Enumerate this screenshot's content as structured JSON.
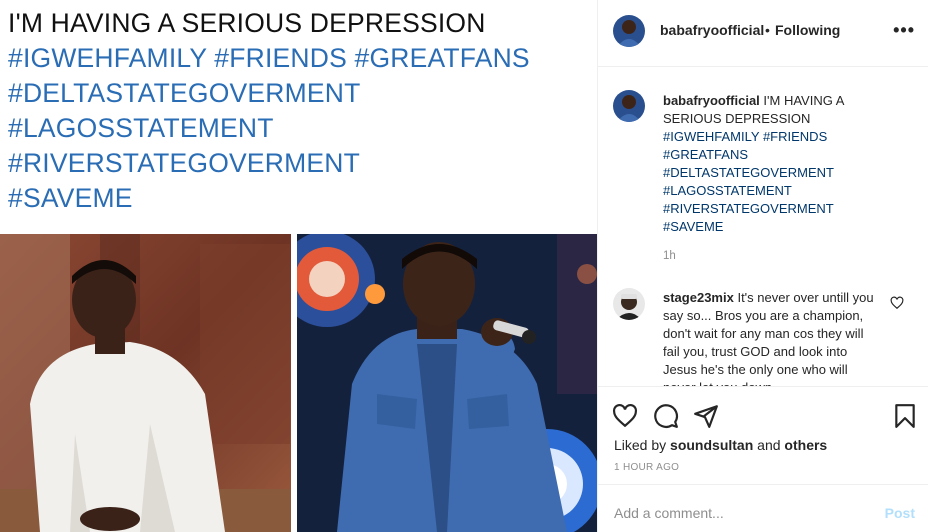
{
  "media": {
    "caption_lines": [
      {
        "text": "I'M HAVING A SERIOUS DEPRESSION",
        "style": "black"
      },
      {
        "text": "#IGWEHFAMILY #FRIENDS #GREATFANS",
        "style": "blue"
      },
      {
        "text": "#DELTASTATEGOVERMENT",
        "style": "blue"
      },
      {
        "text": "#LAGOSSTATEMENT",
        "style": "blue"
      },
      {
        "text": "#RIVERSTATEGOVERMENT",
        "style": "blue"
      },
      {
        "text": "#SAVEME",
        "style": "blue"
      }
    ]
  },
  "header": {
    "username": "babafryoofficial",
    "dot": "•",
    "follow_status": "Following",
    "more": "•••"
  },
  "caption": {
    "username": "babafryoofficial",
    "text": "I'M HAVING A SERIOUS DEPRESSION",
    "hashtags": [
      "#IGWEHFAMILY",
      "#FRIENDS",
      "#GREATFANS",
      "#DELTASTATEGOVERMENT",
      "#LAGOSSTATEMENT",
      "#RIVERSTATEGOVERMENT",
      "#SAVEME"
    ],
    "time": "1h"
  },
  "comment": {
    "username": "stage23mix",
    "text": "It's never over untill you say so... Bros you are a champion, don't wait for any man cos they will fail you, trust GOD and look into Jesus he's the only one who will never let you down"
  },
  "actions": {
    "icons": [
      "heart-icon",
      "comment-icon",
      "share-icon",
      "bookmark-icon"
    ],
    "liked_by_prefix": "Liked by",
    "liked_by_user": "soundsultan",
    "liked_by_and": "and",
    "liked_by_others": "others",
    "time_ago": "1 HOUR AGO"
  },
  "add_comment": {
    "placeholder": "Add a comment...",
    "post_label": "Post"
  },
  "colors": {
    "hashtag_image": "#2a6db5",
    "hashtag_link": "#00376b",
    "post_button_disabled": "#b2dffc",
    "muted": "#8e8e8e"
  }
}
